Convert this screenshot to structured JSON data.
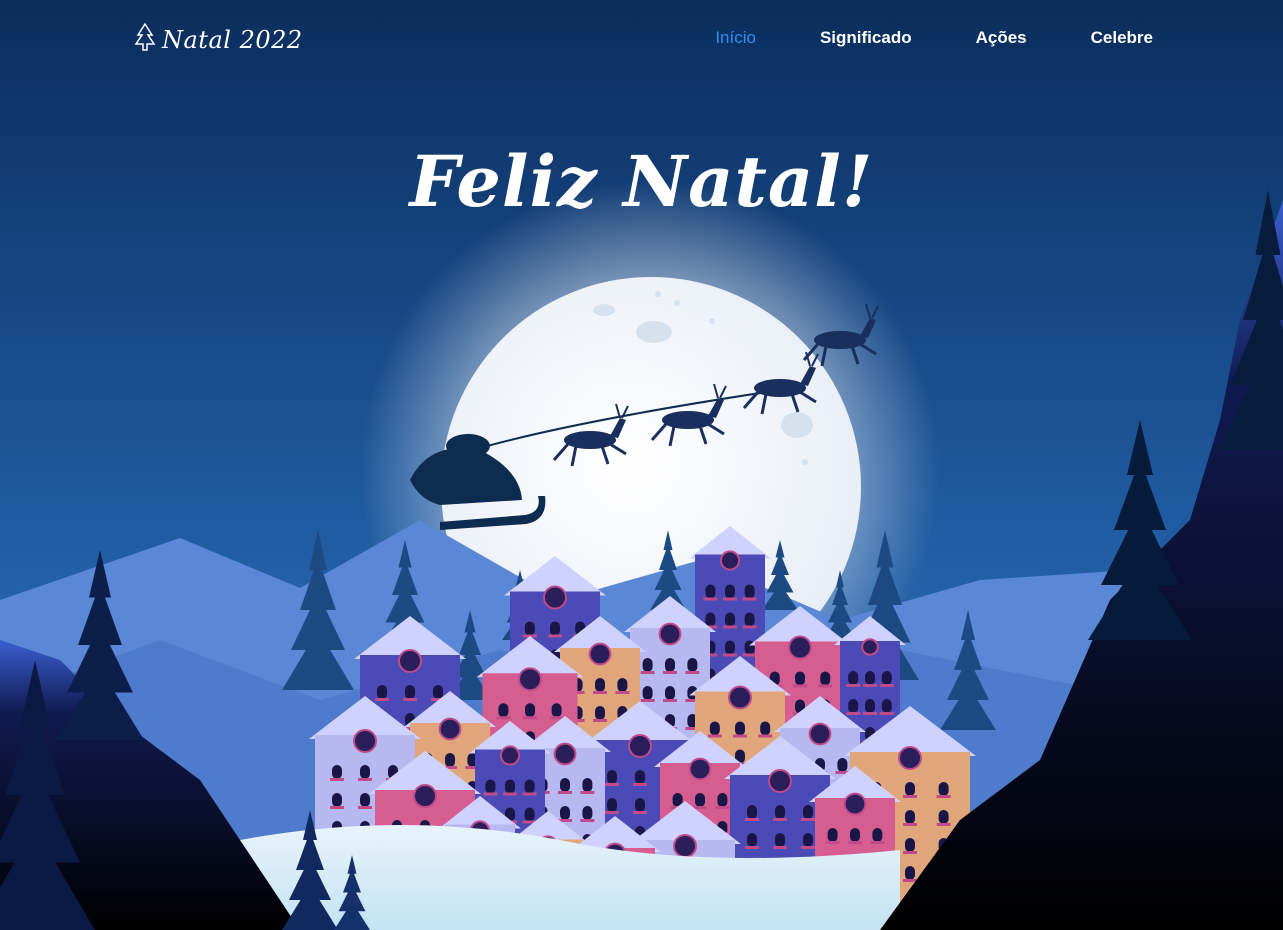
{
  "header": {
    "logo_text": "Natal 2022",
    "nav": [
      {
        "label": "Início",
        "active": true
      },
      {
        "label": "Significado",
        "active": false
      },
      {
        "label": "Ações",
        "active": false
      },
      {
        "label": "Celebre",
        "active": false
      }
    ]
  },
  "hero": {
    "title": "Feliz Natal!"
  },
  "colors": {
    "sky_top": "#0b2d5c",
    "sky_bottom": "#3f7fc6",
    "nav_active": "#2f8ff0",
    "moon": "#f4f7fb",
    "house_blue": "#4c4ab6",
    "house_pink": "#d65d90",
    "house_tan": "#e0a57a",
    "house_lilac": "#b7b8f0"
  }
}
